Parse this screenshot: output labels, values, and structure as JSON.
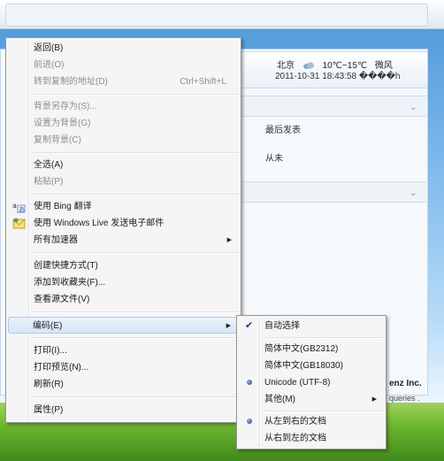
{
  "weather": {
    "city": "北京",
    "temp": "10℃~15℃",
    "wind": "微风",
    "datetime": "2011-10-31 18:43:58 ����h"
  },
  "background": {
    "latest_post": "最后发表",
    "never": "从未",
    "company": "enz Inc.",
    "queries": "queries ."
  },
  "main_menu": {
    "items": [
      {
        "label": "返回(B)",
        "enabled": true
      },
      {
        "label": "前进(O)",
        "enabled": false
      },
      {
        "label": "转到复制的地址(D)",
        "shortcut": "Ctrl+Shift+L",
        "enabled": false
      },
      {
        "label": "背景另存为(S)...",
        "enabled": false
      },
      {
        "label": "设置为背景(G)",
        "enabled": false
      },
      {
        "label": "复制背景(C)",
        "enabled": false
      },
      {
        "label": "全选(A)",
        "enabled": true
      },
      {
        "label": "粘贴(P)",
        "enabled": false
      },
      {
        "label": "使用 Bing 翻译",
        "enabled": true,
        "icon": "translate-icon"
      },
      {
        "label": "使用 Windows Live 发送电子邮件",
        "enabled": true,
        "icon": "email-icon"
      },
      {
        "label": "所有加速器",
        "enabled": true
      },
      {
        "label": "创建快捷方式(T)",
        "enabled": true
      },
      {
        "label": "添加到收藏夹(F)...",
        "enabled": true
      },
      {
        "label": "查看源文件(V)",
        "enabled": true
      },
      {
        "label": "编码(E)",
        "enabled": true
      },
      {
        "label": "打印(I)...",
        "enabled": true
      },
      {
        "label": "打印预览(N)...",
        "enabled": true
      },
      {
        "label": "刷新(R)",
        "enabled": true
      },
      {
        "label": "属性(P)",
        "enabled": true
      }
    ]
  },
  "encoding_menu": {
    "items": [
      {
        "label": "自动选择",
        "checked": true
      },
      {
        "label": "简体中文(GB2312)"
      },
      {
        "label": "简体中文(GB18030)"
      },
      {
        "label": "Unicode (UTF-8)",
        "selected": true
      },
      {
        "label": "其他(M)"
      },
      {
        "label": "从左到右的文档",
        "selected": true
      },
      {
        "label": "从右到左的文档"
      }
    ]
  }
}
